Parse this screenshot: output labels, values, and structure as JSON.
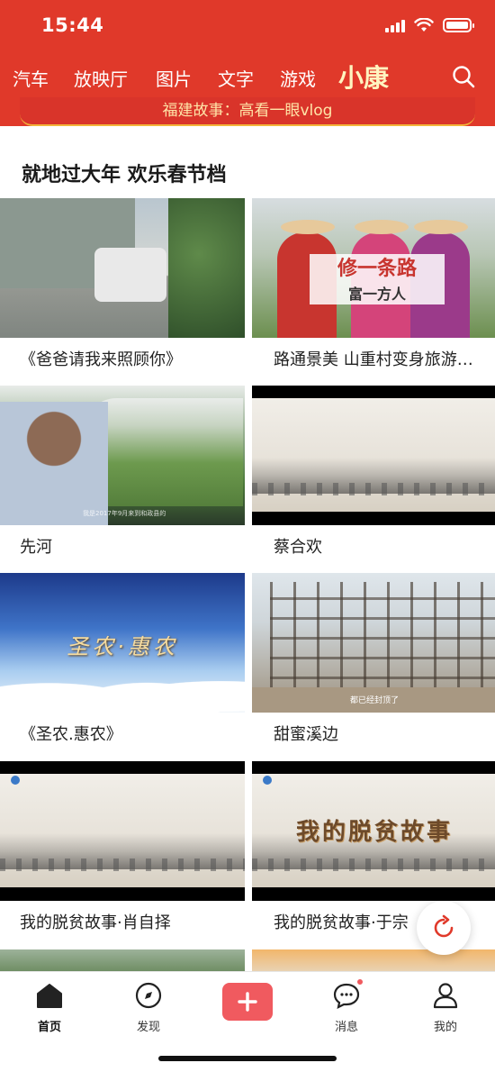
{
  "status_bar": {
    "time": "15:44"
  },
  "nav": {
    "items": [
      "汽车",
      "放映厅",
      "图片",
      "文字",
      "游戏",
      "小康"
    ],
    "active_index": 5,
    "search_icon": "search-icon"
  },
  "banner": {
    "text": "福建故事：高看一眼vlog"
  },
  "section": {
    "title": "就地过大年 欢乐春节档"
  },
  "videos": [
    {
      "title": "《爸爸请我来照顾你》"
    },
    {
      "title": "路通景美 山重村变身旅游…",
      "overlay_line1": "修一条路",
      "overlay_line2": "富一方人"
    },
    {
      "title": "先河",
      "subtitle": "我是2017年9月来到和政县的"
    },
    {
      "title": "蔡合欢"
    },
    {
      "title": "《圣农.惠农》",
      "overlay": "圣农·惠农"
    },
    {
      "title": "甜蜜溪边",
      "subtitle": "都已经封顶了"
    },
    {
      "title": "我的脱贫故事·肖自择"
    },
    {
      "title": "我的脱贫故事·于宗",
      "overlay": "我的脱贫故事"
    }
  ],
  "tabs": [
    {
      "label": "首页",
      "icon": "home-icon",
      "active": true
    },
    {
      "label": "发现",
      "icon": "compass-icon",
      "active": false
    },
    {
      "label": "",
      "icon": "plus-icon",
      "active": false
    },
    {
      "label": "消息",
      "icon": "message-icon",
      "active": false,
      "badge": true
    },
    {
      "label": "我的",
      "icon": "user-icon",
      "active": false
    }
  ],
  "colors": {
    "brand_red": "#e0392a",
    "accent_gold": "#fff4c0",
    "add_button": "#f05a5f"
  }
}
